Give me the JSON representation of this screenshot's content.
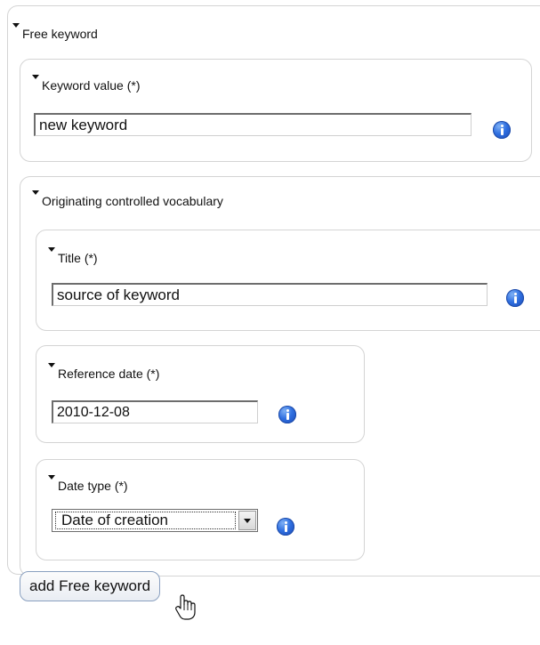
{
  "free_keyword": {
    "legend": "Free keyword",
    "keyword_value": {
      "label": "Keyword value (*)",
      "value": "new keyword"
    },
    "vocabulary": {
      "legend": "Originating controlled vocabulary",
      "title": {
        "label": "Title (*)",
        "value": "source of keyword"
      },
      "reference_date": {
        "label": "Reference date (*)",
        "value": "2010-12-08"
      },
      "date_type": {
        "label": "Date type (*)",
        "selected": "Date of creation"
      }
    }
  },
  "add_button_label": "add Free keyword",
  "icons": {
    "collapse": "triangle-down-icon",
    "info": "info-icon",
    "cursor": "hand-pointer-icon"
  },
  "colors": {
    "info_icon": "#2f6fe0",
    "border": "#d4d4d4"
  }
}
